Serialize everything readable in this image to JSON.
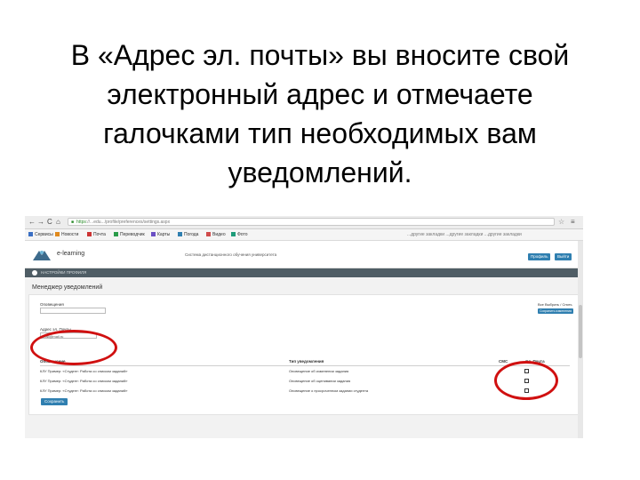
{
  "slide": {
    "title_lines": [
      "В «Адрес эл. почты» вы вносите свой",
      "электронный адрес и отмечаете",
      "галочками тип необходимых вам",
      "уведомлений."
    ]
  },
  "browser": {
    "nav_back": "←",
    "nav_forward": "→",
    "nav_reload": "C",
    "nav_home": "⌂",
    "url_scheme": "https",
    "url_rest": "://...edu.../profile/preferences/settings.aspx",
    "bookmarks": [
      "Сервисы",
      "Новости",
      "Почта",
      "Переводчик",
      "Карты",
      "Погода",
      "Видео",
      "Фото"
    ],
    "bookmarks_right": "...другие закладки ...другие закладки ...другие закладки"
  },
  "site": {
    "logo_text": "e-learning",
    "site_name": "Система дистанционного обучения университета",
    "header_buttons": [
      "Профиль",
      "Выйти"
    ],
    "strip_label": "Настройки профиля"
  },
  "page": {
    "heading": "Менеджер уведомлений",
    "form": {
      "notify_label": "Оповещения",
      "notify_value": "",
      "email_label": "Адрес эл. Почты",
      "email_value": "mail@mail.ru",
      "right_link": "Все Выбрать / Снять",
      "right_button": "Сохранить изменения"
    },
    "table": {
      "headers": [
        "Оповещение",
        "Тип уведомления",
        "СМС",
        "Эл. Почта"
      ],
      "rows": [
        {
          "course": "КЛУ Пример: «Студент: Работа со списком заданий»",
          "type": "Оповещение об изменении задания",
          "sms": false,
          "email": true
        },
        {
          "course": "КЛУ Пример: «Студент: Работа со списком заданий»",
          "type": "Оповещение об оценивании задания",
          "sms": false,
          "email": true
        },
        {
          "course": "КЛУ Пример: «Студент: Работа со списком заданий»",
          "type": "Оповещение о просроченном задании студента",
          "sms": false,
          "email": true
        }
      ]
    },
    "save_button": "Сохранить"
  },
  "colors": {
    "annotation_red": "#d01010",
    "button_blue": "#2f7fb0",
    "nav_strip": "#4f5d65"
  }
}
